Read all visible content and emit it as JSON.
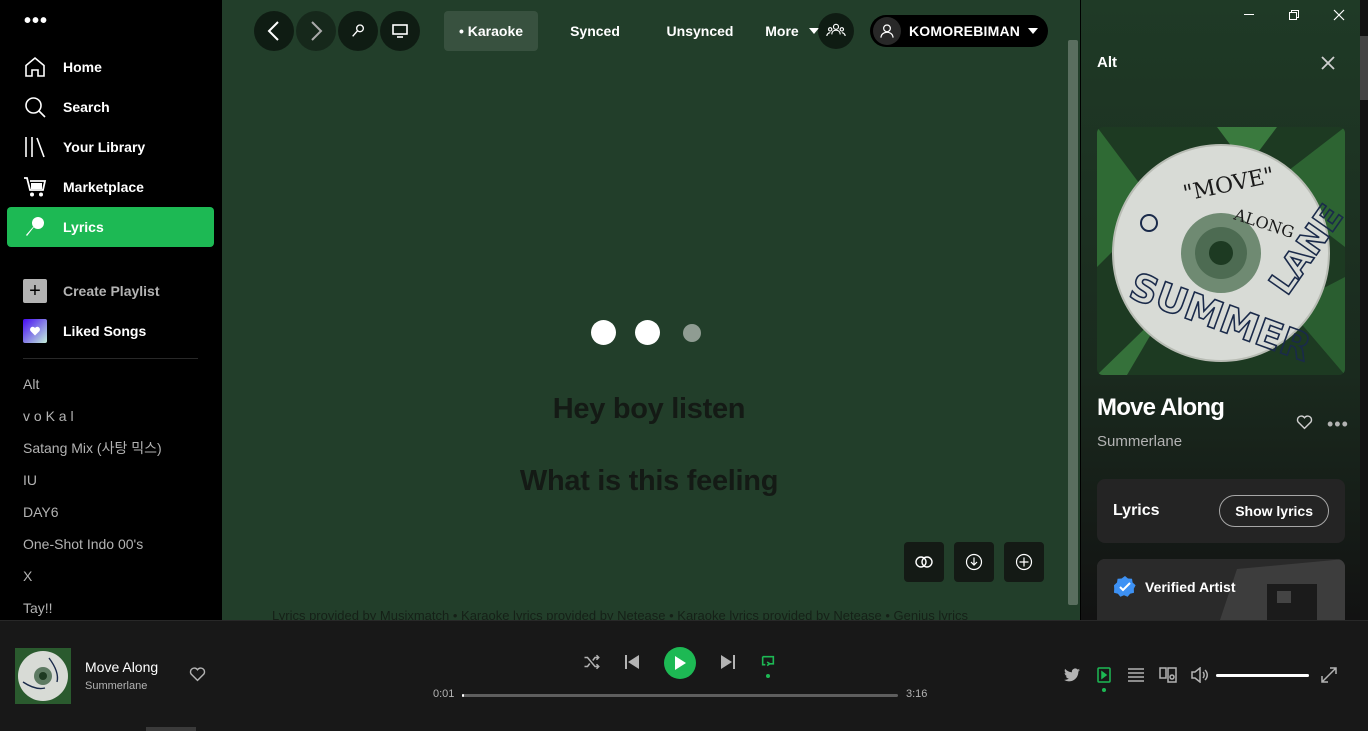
{
  "sidebar": {
    "nav": [
      {
        "label": "Home",
        "icon": "home-icon"
      },
      {
        "label": "Search",
        "icon": "search-icon"
      },
      {
        "label": "Your Library",
        "icon": "library-icon"
      },
      {
        "label": "Marketplace",
        "icon": "cart-icon"
      },
      {
        "label": "Lyrics",
        "icon": "microphone-icon",
        "active": true
      }
    ],
    "create_playlist": "Create Playlist",
    "liked_songs": "Liked Songs",
    "playlists": [
      "Alt",
      "v o K a l",
      "Satang Mix (사탕 믹스)",
      "IU",
      "DAY6",
      "One-Shot Indo 00's",
      "X",
      "Tay!!"
    ]
  },
  "topbar": {
    "tabs": {
      "karaoke": "• Karaoke",
      "synced": "Synced",
      "unsynced": "Unsynced",
      "more": "More"
    },
    "user": "KOMOREBIMAN"
  },
  "lyrics": {
    "lines": [
      "Hey boy listen",
      "What is this feeling"
    ],
    "credits": "Lyrics provided by Musixmatch • Karaoke lyrics provided by Netease • Karaoke lyrics provided by Netease • Genius lyrics"
  },
  "right_panel": {
    "title": "Alt",
    "song": "Move Along",
    "artist": "Summerlane",
    "lyrics_label": "Lyrics",
    "show_lyrics": "Show lyrics",
    "verified": "Verified Artist"
  },
  "player": {
    "title": "Move Along",
    "artist": "Summerlane",
    "elapsed": "0:01",
    "duration": "3:16",
    "progress_fraction": 0.005,
    "volume_fraction": 1.0
  },
  "colors": {
    "accent": "#1db954",
    "lyrics_bg": "#223e2a",
    "lyrics_text": "#141a15"
  }
}
